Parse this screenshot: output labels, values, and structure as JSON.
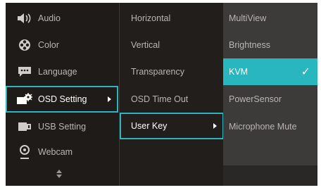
{
  "menu": {
    "level1": [
      {
        "label": "Audio",
        "icon": "speaker-icon"
      },
      {
        "label": "Color",
        "icon": "color-wheel-icon"
      },
      {
        "label": "Language",
        "icon": "speech-bubble-icon"
      },
      {
        "label": "OSD Setting",
        "icon": "monitor-gear-icon"
      },
      {
        "label": "USB Setting",
        "icon": "usb-icon"
      },
      {
        "label": "Webcam",
        "icon": "webcam-icon"
      }
    ],
    "level2": [
      {
        "label": "Horizontal"
      },
      {
        "label": "Vertical"
      },
      {
        "label": "Transparency"
      },
      {
        "label": "OSD Time Out"
      },
      {
        "label": "User Key"
      }
    ],
    "level3": [
      {
        "label": "MultiView"
      },
      {
        "label": "Brightness"
      },
      {
        "label": "KVM"
      },
      {
        "label": "PowerSensor"
      },
      {
        "label": "Microphone Mute"
      }
    ],
    "check_glyph": "✓"
  },
  "colors": {
    "accent": "#2ab6bf",
    "panel": "#1f1b19",
    "submenu": "#3c3b3a"
  }
}
